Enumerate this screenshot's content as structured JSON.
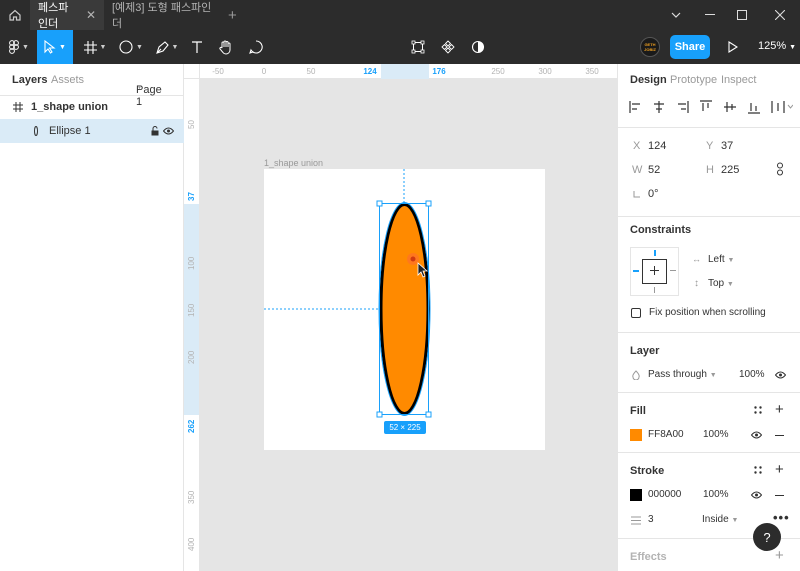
{
  "tabs": [
    "페스파인더",
    "[예제3] 도형 패스파인더"
  ],
  "toolbar": {
    "share_label": "Share",
    "zoom": "125%",
    "avatar_text": "GETH JOBIZ"
  },
  "left_panel": {
    "tab_layers": "Layers",
    "tab_assets": "Assets",
    "page_selector": "Page 1",
    "layers": [
      {
        "name": "1_shape union"
      },
      {
        "name": "Ellipse 1"
      }
    ]
  },
  "rulers": {
    "top": [
      "-50",
      "0",
      "50",
      "124",
      "176",
      "250",
      "300",
      "350"
    ],
    "left": [
      "50",
      "37",
      "100",
      "150",
      "200",
      "262",
      "350",
      "400"
    ]
  },
  "canvas": {
    "frame_name": "1_shape union",
    "size_badge": "52 × 225"
  },
  "right_panel": {
    "tab_design": "Design",
    "tab_prototype": "Prototype",
    "tab_inspect": "Inspect",
    "x_label": "X",
    "x_value": "124",
    "y_label": "Y",
    "y_value": "37",
    "w_label": "W",
    "w_value": "52",
    "h_label": "H",
    "h_value": "225",
    "rotation": "0°",
    "constraints_title": "Constraints",
    "constraint_h": "Left",
    "constraint_v": "Top",
    "fix_position": "Fix position when scrolling",
    "layer_title": "Layer",
    "blend_mode": "Pass through",
    "layer_opacity": "100%",
    "fill_title": "Fill",
    "fill_hex": "FF8A00",
    "fill_opacity": "100%",
    "fill_color": "#ff8a00",
    "stroke_title": "Stroke",
    "stroke_hex": "000000",
    "stroke_opacity": "100%",
    "stroke_color": "#000000",
    "stroke_weight": "3",
    "stroke_align": "Inside",
    "effects_title": "Effects",
    "help_label": "?"
  },
  "colors": {
    "accent": "#18a0fb",
    "toolbar_bg": "#2c2c2c",
    "ellipse_fill": "#ff8a00"
  }
}
